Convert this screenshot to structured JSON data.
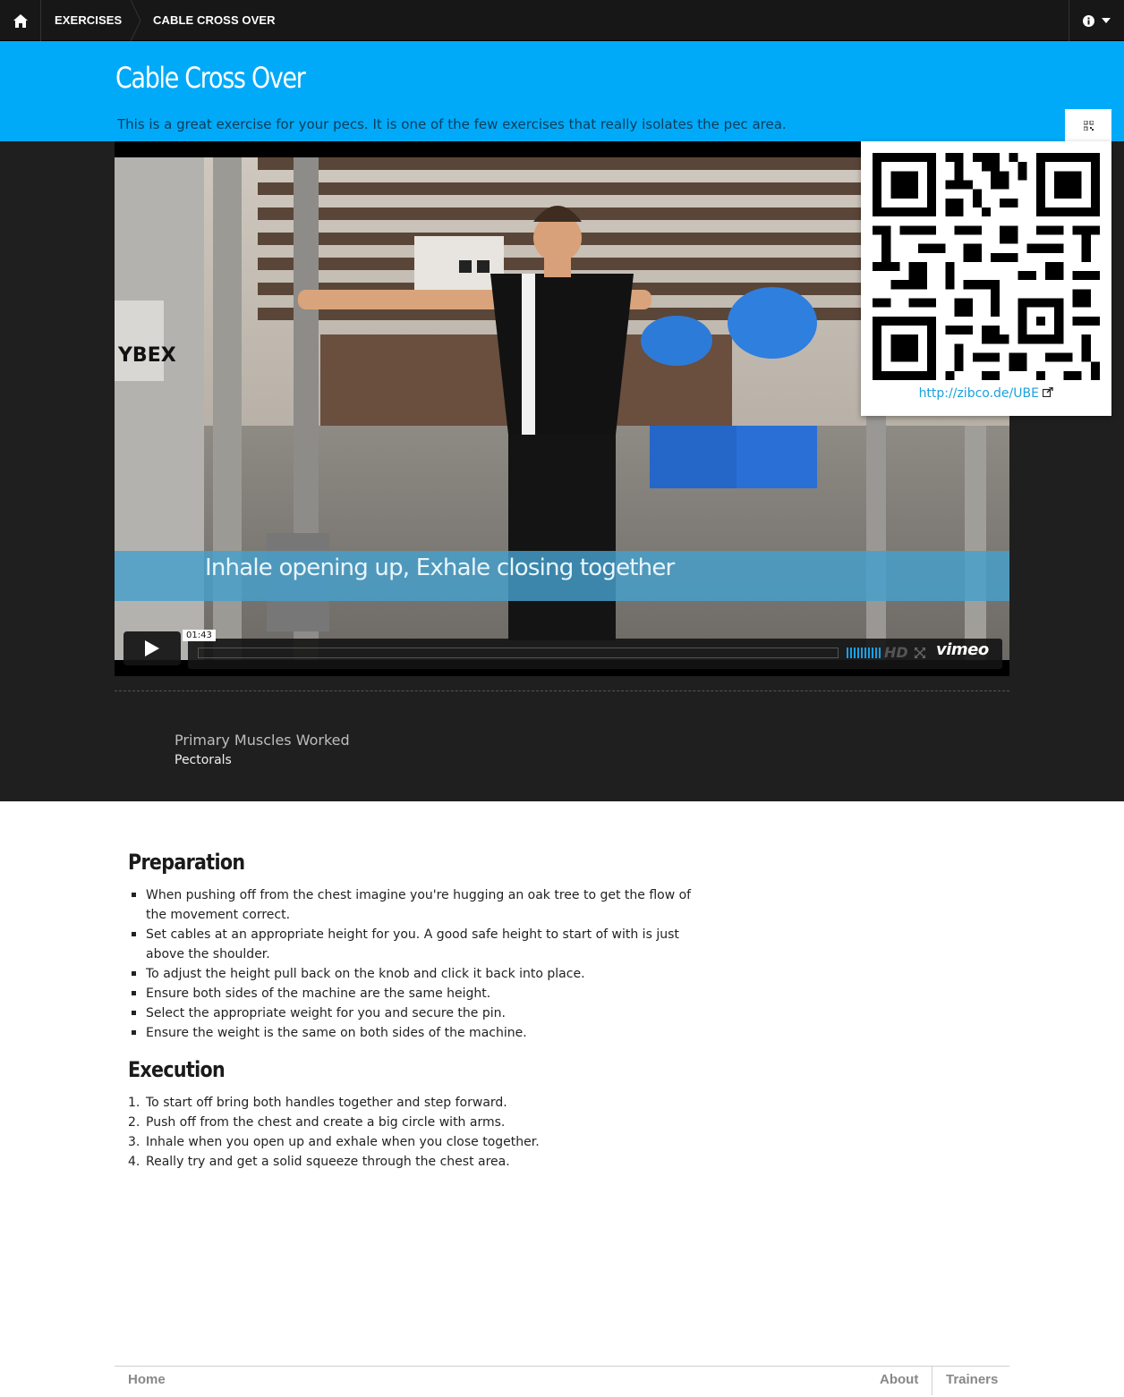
{
  "nav": {
    "home_icon": "home-icon",
    "breadcrumbs": [
      "EXERCISES",
      "CABLE CROSS OVER"
    ],
    "info_icon": "info-circle-icon",
    "caret_icon": "caret-down-icon"
  },
  "header": {
    "title": "Cable Cross Over",
    "description": "This is a great exercise for your pecs. It is one of the few exercises that really isolates the pec area.",
    "qr_tab_icon": "qrcode-icon",
    "background": "#00aaf8"
  },
  "video": {
    "caption": "Inhale opening up, Exhale closing together",
    "timecode": "01:43",
    "quality_label": "HD",
    "brand": "vimeo",
    "play_icon": "play-icon",
    "fullscreen_icon": "fullscreen-icon",
    "progress": 0
  },
  "qr_popover": {
    "link_text": "http://zibco.de/UBE",
    "external_icon": "external-link-icon"
  },
  "muscles": {
    "title": "Primary Muscles Worked",
    "value": "Pectorals"
  },
  "preparation": {
    "title": "Preparation",
    "items": [
      "When pushing off from the chest imagine you're hugging an oak tree to get the flow of the movement correct.",
      "Set cables at an appropriate height for you. A good safe height to start of with is just above the shoulder.",
      "To adjust the height pull back on the knob and click it back into place.",
      "Ensure both sides of the machine are the same height.",
      "Select the appropriate weight for you and secure the pin.",
      "Ensure the weight is the same on both sides of the machine."
    ]
  },
  "execution": {
    "title": "Execution",
    "items": [
      "To start off bring both handles together and step forward.",
      "Push off from the chest and create a big circle with arms.",
      "Inhale when you open up and exhale when you close together.",
      "Really try and get a solid squeeze through the chest area."
    ],
    "numbers": [
      "1.",
      "2.",
      "3.",
      "4."
    ]
  },
  "footer": {
    "home": "Home",
    "about": "About",
    "trainers": "Trainers"
  }
}
